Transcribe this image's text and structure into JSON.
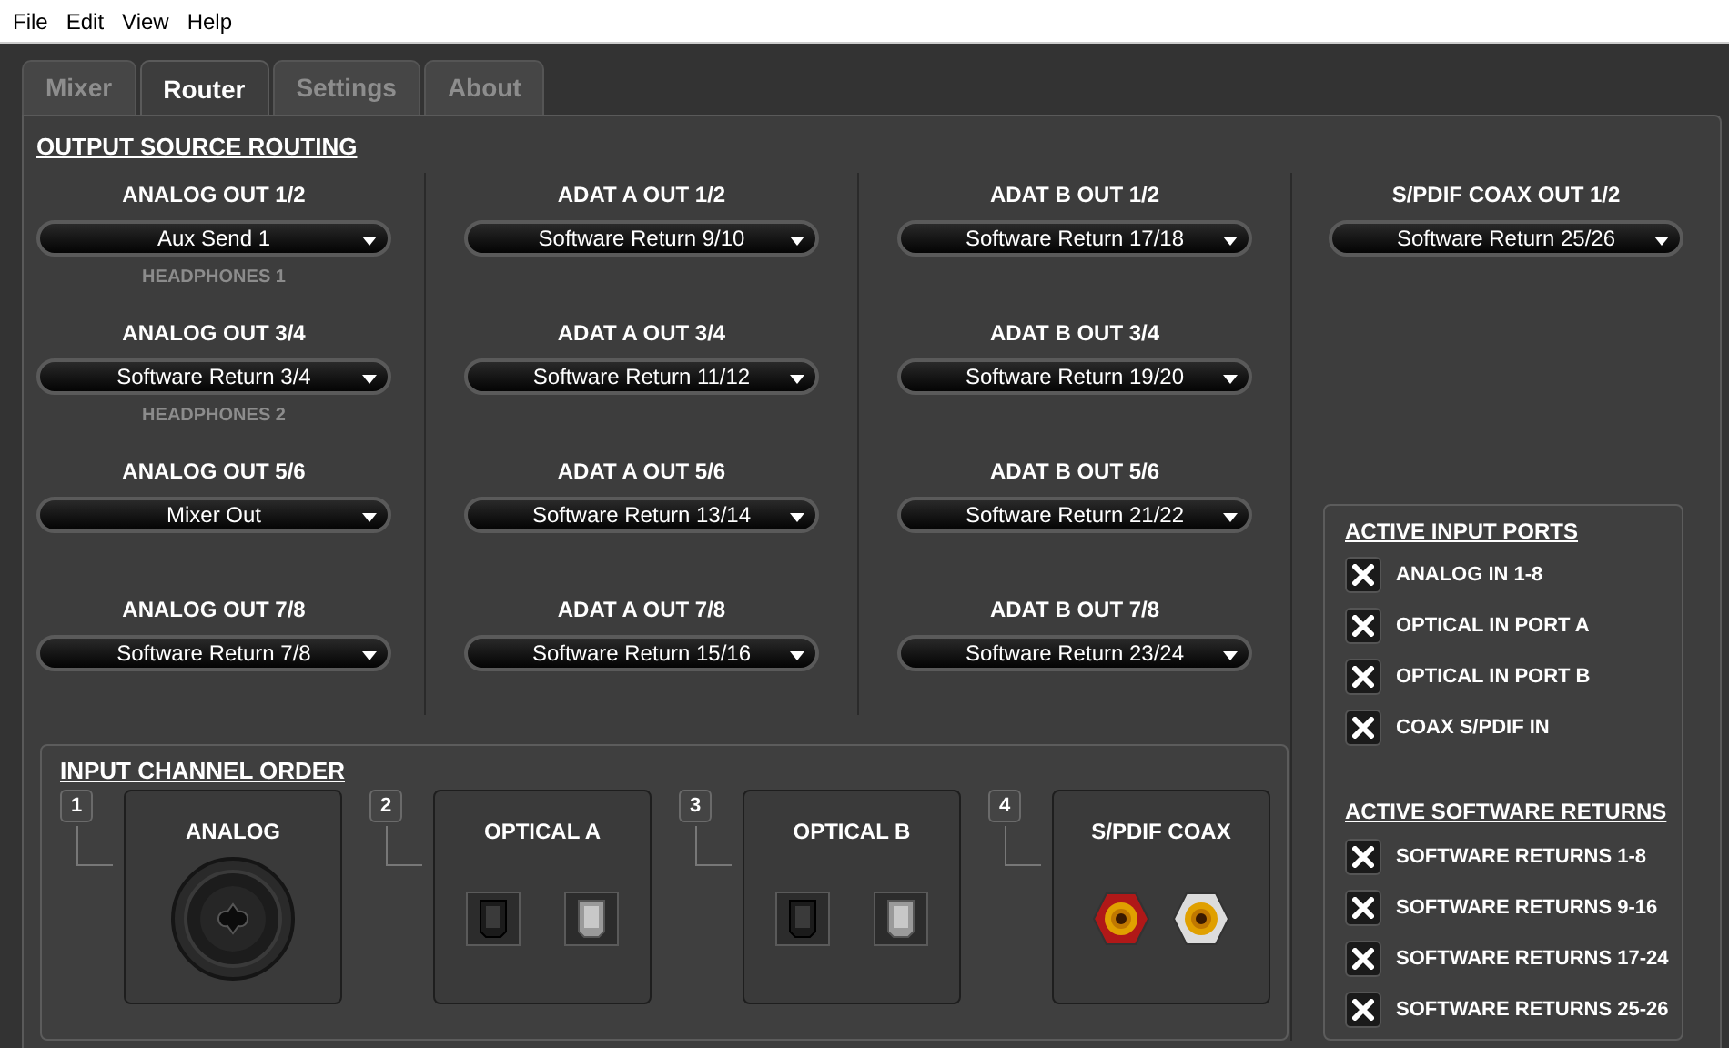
{
  "menu": [
    "File",
    "Edit",
    "View",
    "Help"
  ],
  "tabs": [
    {
      "label": "Mixer",
      "selected": false
    },
    {
      "label": "Router",
      "selected": true
    },
    {
      "label": "Settings",
      "selected": false
    },
    {
      "label": "About",
      "selected": false
    }
  ],
  "routing": {
    "title": "OUTPUT SOURCE ROUTING",
    "columns": [
      {
        "outputs": [
          {
            "label": "ANALOG OUT 1/2",
            "value": "Aux Send 1",
            "sublabel": "HEADPHONES 1"
          },
          {
            "label": "ANALOG OUT 3/4",
            "value": "Software Return 3/4",
            "sublabel": "HEADPHONES 2"
          },
          {
            "label": "ANALOG OUT 5/6",
            "value": "Mixer Out"
          },
          {
            "label": "ANALOG OUT 7/8",
            "value": "Software Return 7/8"
          }
        ]
      },
      {
        "outputs": [
          {
            "label": "ADAT A OUT 1/2",
            "value": "Software Return 9/10"
          },
          {
            "label": "ADAT A OUT 3/4",
            "value": "Software Return 11/12"
          },
          {
            "label": "ADAT A OUT 5/6",
            "value": "Software Return 13/14"
          },
          {
            "label": "ADAT A OUT 7/8",
            "value": "Software Return 15/16"
          }
        ]
      },
      {
        "outputs": [
          {
            "label": "ADAT B OUT 1/2",
            "value": "Software Return 17/18"
          },
          {
            "label": "ADAT B OUT 3/4",
            "value": "Software Return 19/20"
          },
          {
            "label": "ADAT B OUT 5/6",
            "value": "Software Return 21/22"
          },
          {
            "label": "ADAT B OUT 7/8",
            "value": "Software Return 23/24"
          }
        ]
      },
      {
        "outputs": [
          {
            "label": "S/PDIF COAX OUT 1/2",
            "value": "Software Return 25/26"
          }
        ]
      }
    ]
  },
  "input_order": {
    "title": "INPUT CHANNEL ORDER",
    "slots": [
      {
        "number": "1",
        "label": "ANALOG",
        "kind": "xlr"
      },
      {
        "number": "2",
        "label": "OPTICAL A",
        "kind": "optical"
      },
      {
        "number": "3",
        "label": "OPTICAL B",
        "kind": "optical"
      },
      {
        "number": "4",
        "label": "S/PDIF COAX",
        "kind": "coax"
      }
    ]
  },
  "active_inputs": {
    "title": "ACTIVE INPUT PORTS",
    "items": [
      {
        "label": "ANALOG IN 1-8",
        "checked": true
      },
      {
        "label": "OPTICAL IN PORT A",
        "checked": true
      },
      {
        "label": "OPTICAL IN PORT B",
        "checked": true
      },
      {
        "label": "COAX S/PDIF IN",
        "checked": true
      }
    ]
  },
  "active_returns": {
    "title": "ACTIVE SOFTWARE RETURNS",
    "items": [
      {
        "label": "SOFTWARE RETURNS 1-8",
        "checked": true
      },
      {
        "label": "SOFTWARE RETURNS 9-16",
        "checked": true
      },
      {
        "label": "SOFTWARE RETURNS 17-24",
        "checked": true
      },
      {
        "label": "SOFTWARE RETURNS 25-26",
        "checked": true
      }
    ]
  }
}
